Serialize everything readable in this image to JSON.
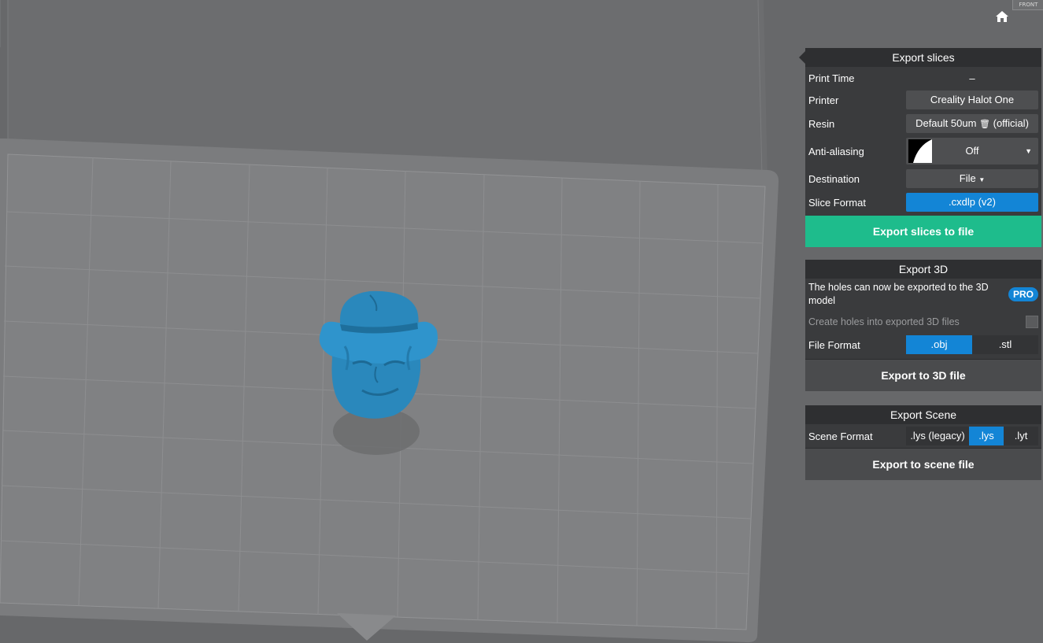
{
  "view_cube_label": "FRONT",
  "export_slices": {
    "title": "Export slices",
    "print_time_label": "Print Time",
    "print_time_value": "–",
    "printer_label": "Printer",
    "printer_value": "Creality Halot One",
    "resin_label": "Resin",
    "resin_value": "Default 50um",
    "resin_suffix": "(official)",
    "antialiasing_label": "Anti-aliasing",
    "antialiasing_value": "Off",
    "destination_label": "Destination",
    "destination_value": "File",
    "slice_format_label": "Slice Format",
    "slice_format_value": ".cxdlp (v2)",
    "export_button": "Export slices to file"
  },
  "export_3d": {
    "title": "Export 3D",
    "notice": "The holes can now be exported to the 3D model",
    "pro_badge": "PRO",
    "create_holes_label": "Create holes into exported 3D files",
    "file_format_label": "File Format",
    "formats": [
      ".obj",
      ".stl"
    ],
    "selected_format": ".obj",
    "export_button": "Export to 3D file"
  },
  "export_scene": {
    "title": "Export Scene",
    "scene_format_label": "Scene Format",
    "formats": [
      ".lys (legacy)",
      ".lys",
      ".lyt"
    ],
    "selected_format": ".lys",
    "export_button": "Export to scene file"
  },
  "colors": {
    "accent_blue": "#1385d6",
    "export_green": "#1ebc8c",
    "model_blue": "#2a88bc"
  }
}
